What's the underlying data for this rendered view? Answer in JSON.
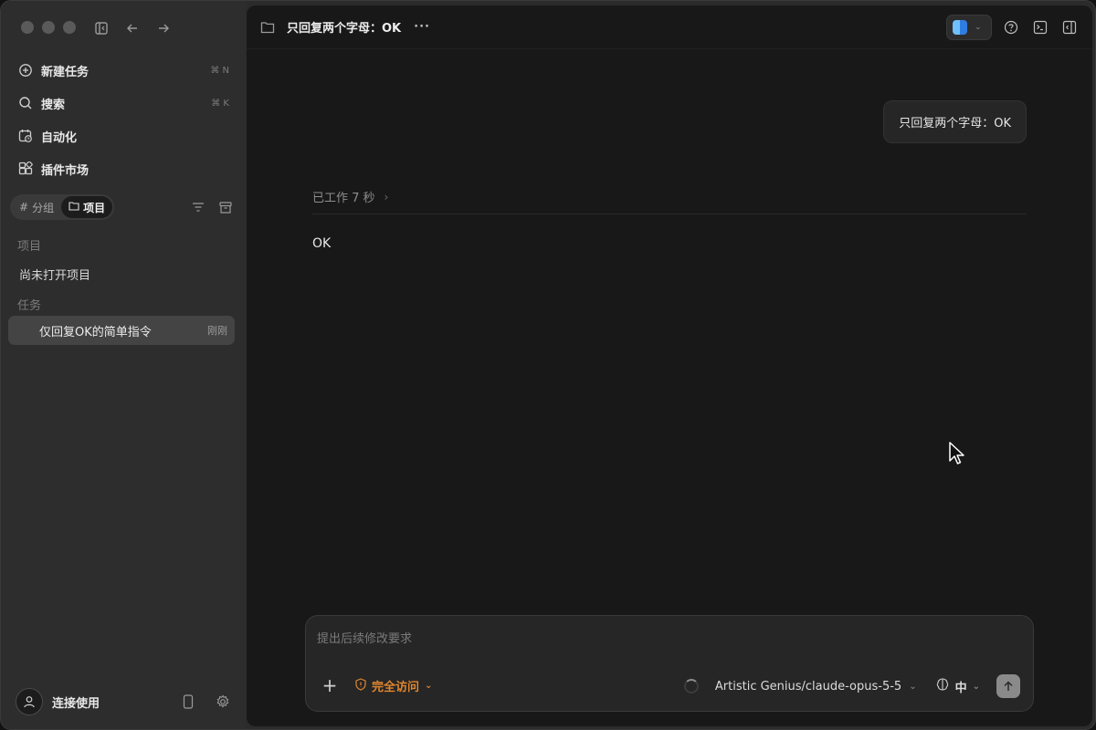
{
  "sidebar": {
    "menu": [
      {
        "label": "新建任务",
        "shortcut": "⌘ N",
        "icon": "new-task-icon"
      },
      {
        "label": "搜索",
        "shortcut": "⌘ K",
        "icon": "search-icon"
      },
      {
        "label": "自动化",
        "shortcut": "",
        "icon": "calendar-clock-icon"
      },
      {
        "label": "插件市场",
        "shortcut": "",
        "icon": "plugins-icon"
      }
    ],
    "segments": [
      {
        "label": "分组",
        "icon": "hash-icon"
      },
      {
        "label": "项目",
        "icon": "folder-icon"
      }
    ],
    "projects_label": "项目",
    "no_project": "尚未打开项目",
    "tasks_label": "任务",
    "task": {
      "label": "仅回复OK的简单指令",
      "time": "刚刚"
    },
    "footer_label": "连接使用"
  },
  "header": {
    "title": "只回复两个字母：OK",
    "more": "···"
  },
  "conversation": {
    "user_message": "只回复两个字母：OK",
    "worked": "已工作 7 秒",
    "reply": "OK"
  },
  "composer": {
    "placeholder": "提出后续修改要求",
    "access": "完全访问",
    "model": "Artistic Genius/claude-opus-5-5",
    "lang": "中"
  },
  "colors": {
    "accent_orange": "#e0862e",
    "sidebar_bg": "#2d2d2d",
    "main_bg": "#181818"
  }
}
